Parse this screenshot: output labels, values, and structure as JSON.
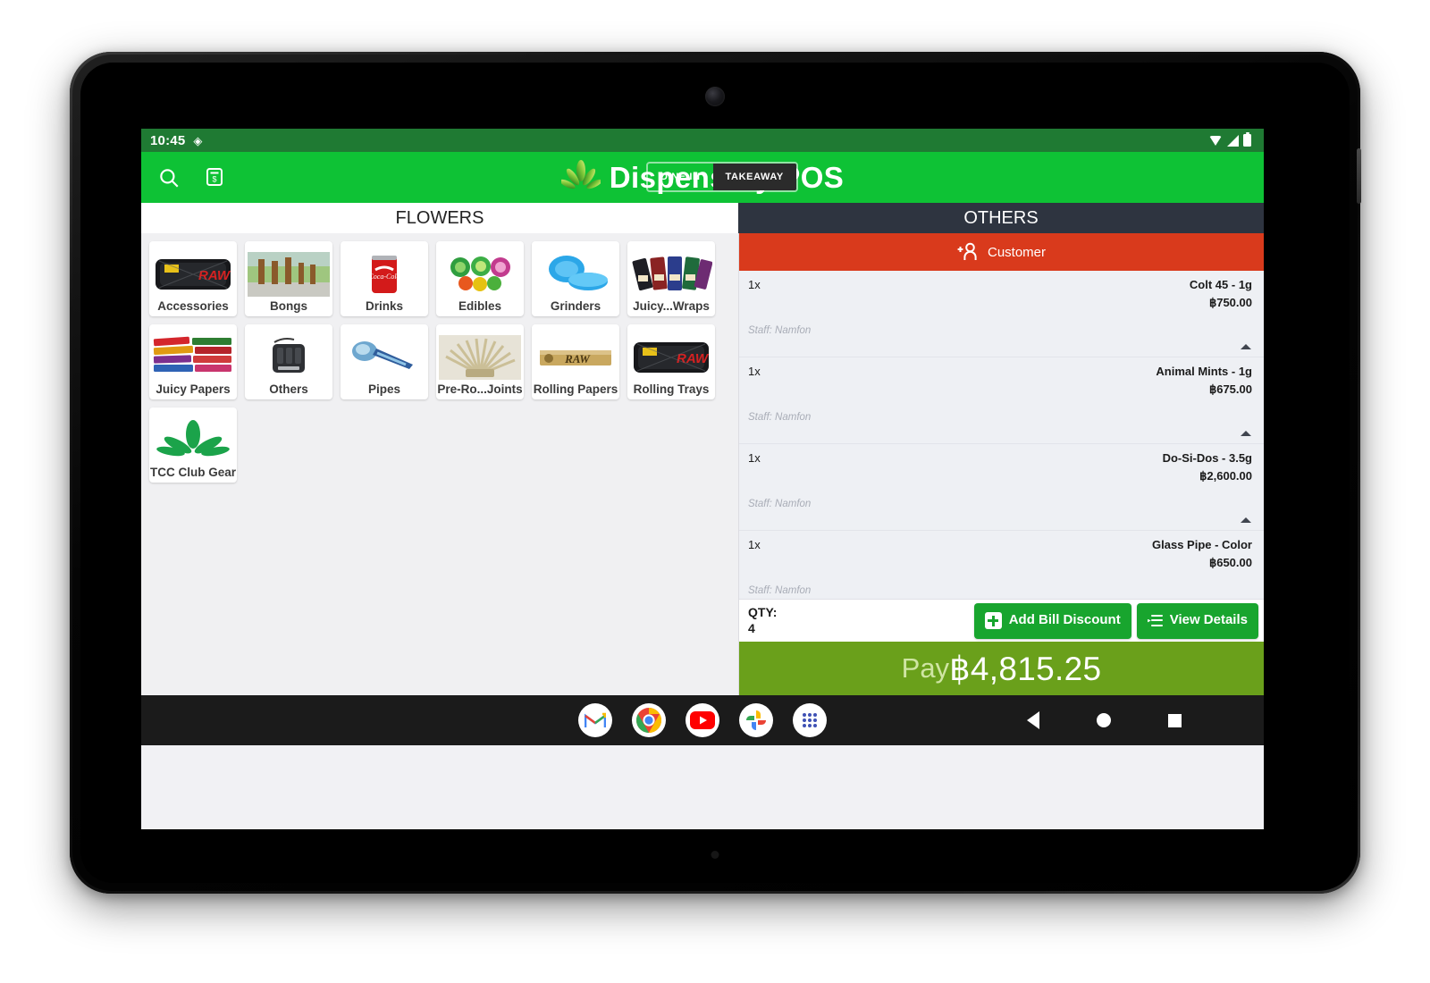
{
  "status_bar": {
    "time": "10:45",
    "left_icon": "location-pin-icon",
    "icons": [
      "wifi-icon",
      "cellular-signal-icon",
      "battery-icon"
    ]
  },
  "app_bar": {
    "title": "Dispensary POS",
    "logo_icon": "cannabis-leaf-icon",
    "search_icon": "search-icon",
    "receipt_icon": "receipt-icon",
    "modes": [
      {
        "label": "DINE IN",
        "active": false
      },
      {
        "label": "TAKEAWAY",
        "active": true
      }
    ],
    "accent_color": "#0ec235"
  },
  "tabs": [
    {
      "label": "FLOWERS",
      "active": true
    },
    {
      "label": "OTHERS",
      "active": false
    }
  ],
  "categories": [
    {
      "label": "Accessories",
      "thumb": "rolling-tray-photo"
    },
    {
      "label": "Bongs",
      "thumb": "bongs-photo"
    },
    {
      "label": "Drinks",
      "thumb": "soda-can-photo"
    },
    {
      "label": "Edibles",
      "thumb": "gummies-photo"
    },
    {
      "label": "Grinders",
      "thumb": "grinder-photo"
    },
    {
      "label": "Juicy...Wraps",
      "thumb": "wraps-photo"
    },
    {
      "label": "Juicy Papers",
      "thumb": "papers-photo"
    },
    {
      "label": "Others",
      "thumb": "vaporizer-photo"
    },
    {
      "label": "Pipes",
      "thumb": "glass-pipe-photo"
    },
    {
      "label": "Pre-Ro...Joints",
      "thumb": "prerolls-photo"
    },
    {
      "label": "Rolling Papers",
      "thumb": "raw-papers-photo"
    },
    {
      "label": "Rolling Trays",
      "thumb": "rolling-tray-photo"
    },
    {
      "label": "TCC Club Gear",
      "thumb": "cannabis-leaf-logo"
    }
  ],
  "cart": {
    "customer_button": {
      "label": "Customer",
      "icon": "add-person-icon",
      "color": "#d93a1c"
    },
    "items": [
      {
        "qty": "1x",
        "name": "Colt 45 - 1g",
        "price": "฿750.00",
        "staff": "Staff: Namfon"
      },
      {
        "qty": "1x",
        "name": "Animal Mints - 1g",
        "price": "฿675.00",
        "staff": "Staff: Namfon"
      },
      {
        "qty": "1x",
        "name": "Do-Si-Dos - 3.5g",
        "price": "฿2,600.00",
        "staff": "Staff: Namfon"
      },
      {
        "qty": "1x",
        "name": "Glass Pipe - Color",
        "price": "฿650.00",
        "staff": "Staff: Namfon"
      }
    ],
    "summary": {
      "qty_label": "QTY:",
      "qty_value": "4",
      "add_discount_label": "Add Bill Discount",
      "view_details_label": "View Details"
    },
    "pay": {
      "word": "Pay",
      "amount": "฿4,815.25",
      "color": "#6aa01b"
    }
  },
  "nav_bar": {
    "dock": [
      "gmail-icon",
      "chrome-icon",
      "youtube-icon",
      "google-photos-icon",
      "app-drawer-icon"
    ],
    "keys": [
      "back-button",
      "home-button",
      "recents-button"
    ]
  }
}
